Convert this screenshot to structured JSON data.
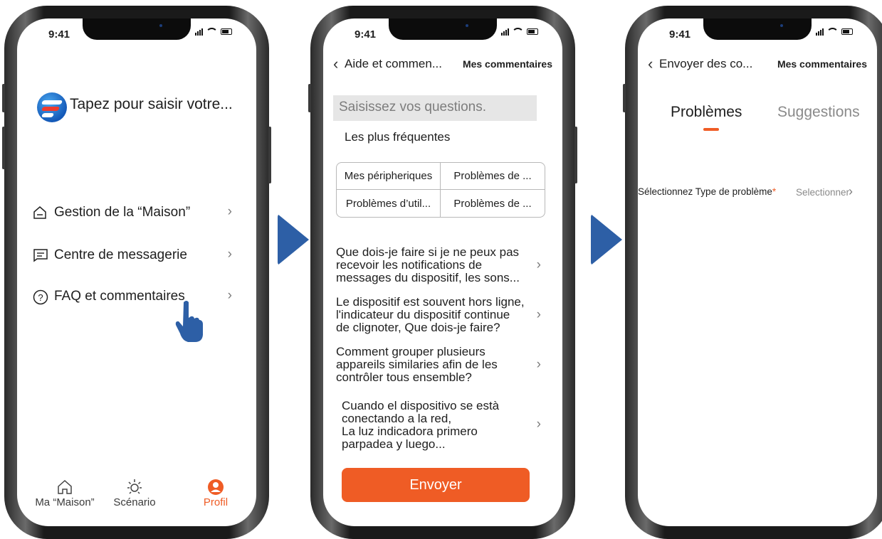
{
  "status": {
    "time": "9:41"
  },
  "screen1": {
    "brand_title": "Tapez pour saisir votre...",
    "menu": [
      {
        "icon": "home-outline-icon",
        "label": "Gestion de la “Maison”"
      },
      {
        "icon": "message-box-icon",
        "label": "Centre de messagerie"
      },
      {
        "icon": "question-circle-icon",
        "label": "FAQ et commentaires"
      }
    ],
    "tabs": [
      {
        "icon": "home-icon",
        "label": "Ma “Maison”"
      },
      {
        "icon": "sun-icon",
        "label": "Scénario"
      },
      {
        "icon": "profile-icon",
        "label": "Profil",
        "active": true
      }
    ]
  },
  "screen2": {
    "title": "Aide et commen...",
    "right_link": "Mes commentaires",
    "search_placeholder": "Saisissez vos questions.",
    "section_title": "Les plus fréquentes",
    "categories": [
      "Mes péripheriques",
      "Problèmes de ...",
      "Problèmes d’util...",
      "Problèmes de ..."
    ],
    "faqs": [
      [
        "Que dois-je faire si je ne peux pas",
        "recevoir les notifications de",
        "messages du dispositif, les sons..."
      ],
      [
        "Le dispositif est souvent hors ligne,",
        "l'indicateur du dispositif continue",
        "de clignoter, Que dois-je faire?"
      ],
      [
        "Comment grouper plusieurs",
        "appareils similaries afin de les",
        "contrôler tous ensemble?"
      ],
      [
        "Cuando el dispositivo se està",
        "conectando a la red,",
        "La luz indicadora primero",
        "parpadea y luego..."
      ]
    ],
    "send_button": "Envoyer"
  },
  "screen3": {
    "title": "Envoyer des co...",
    "right_link": "Mes commentaires",
    "tab_active": "Problèmes",
    "tab_inactive": "Suggestions",
    "field_label": "Sélectionnez Type de problème",
    "required_mark": "*",
    "select_text": "Selectionner"
  },
  "colors": {
    "accent": "#ef5c25",
    "arrow": "#2d5fa6",
    "logo": "#1459b8"
  }
}
